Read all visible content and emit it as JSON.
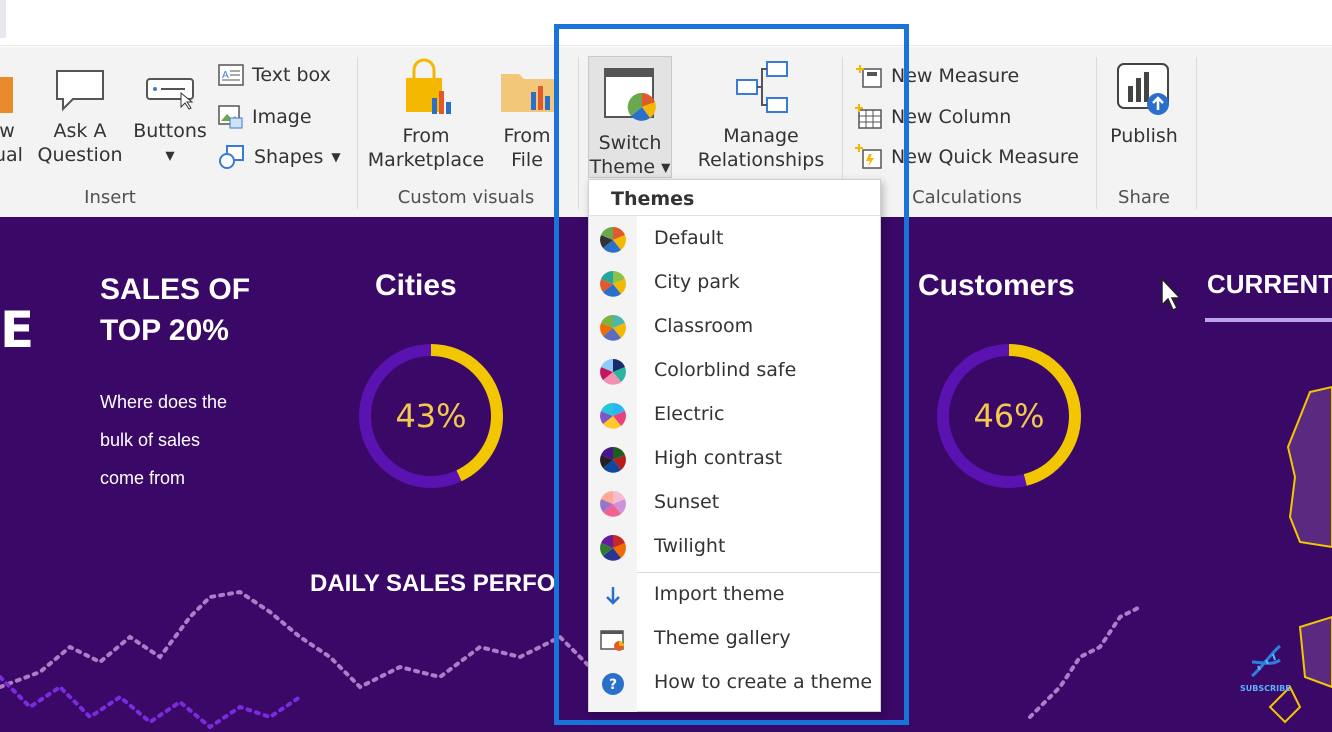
{
  "ribbon": {
    "insert": {
      "new_visual_fragment_1": "w",
      "new_visual_fragment_2": "ual",
      "ask_a_question_1": "Ask A",
      "ask_a_question_2": "Question",
      "buttons": "Buttons",
      "text_box": "Text box",
      "image": "Image",
      "shapes": "Shapes",
      "group_label": "Insert"
    },
    "custom_visuals": {
      "from_marketplace_1": "From",
      "from_marketplace_2": "Marketplace",
      "from_file_1": "From",
      "from_file_2": "File",
      "group_label": "Custom visuals"
    },
    "themes": {
      "switch_theme_1": "Switch",
      "switch_theme_2": "Theme"
    },
    "relationships": {
      "manage_1": "Manage",
      "manage_2": "Relationships"
    },
    "calculations": {
      "new_measure": "New Measure",
      "new_column": "New Column",
      "new_quick_measure": "New Quick Measure",
      "group_label": "Calculations"
    },
    "share": {
      "publish": "Publish",
      "group_label": "Share"
    }
  },
  "dropdown": {
    "header": "Themes",
    "themes": [
      {
        "label": "Default",
        "icon": "default-theme-icon"
      },
      {
        "label": "City park",
        "icon": "city-park-theme-icon"
      },
      {
        "label": "Classroom",
        "icon": "classroom-theme-icon"
      },
      {
        "label": "Colorblind safe",
        "icon": "colorblind-safe-theme-icon"
      },
      {
        "label": "Electric",
        "icon": "electric-theme-icon"
      },
      {
        "label": "High contrast",
        "icon": "high-contrast-theme-icon"
      },
      {
        "label": "Sunset",
        "icon": "sunset-theme-icon"
      },
      {
        "label": "Twilight",
        "icon": "twilight-theme-icon"
      }
    ],
    "actions": [
      {
        "label": "Import theme",
        "icon": "import-arrow-icon"
      },
      {
        "label": "Theme gallery",
        "icon": "theme-gallery-icon"
      },
      {
        "label": "How to create a theme",
        "icon": "help-icon"
      }
    ]
  },
  "canvas": {
    "big_letter": "E",
    "sales_title_1": "SALES OF",
    "sales_title_2": "TOP 20%",
    "sales_desc_1": "Where does the",
    "sales_desc_2": "bulk of sales",
    "sales_desc_3": "come from",
    "cities_title": "Cities",
    "cities_value": "43%",
    "cities_fraction": 0.43,
    "customers_title": "Customers",
    "customers_value": "46%",
    "customers_fraction": 0.46,
    "current_title": "CURRENT",
    "daily_title": "DAILY SALES PERFO",
    "subscribe": "SUBSCRIBE"
  },
  "colors": {
    "canvas_bg": "#3a0866",
    "donut_track": "#5a12b0",
    "donut_fill": "#f2c600",
    "highlight": "#1a73d9",
    "accent_text": "#f2c94c"
  }
}
